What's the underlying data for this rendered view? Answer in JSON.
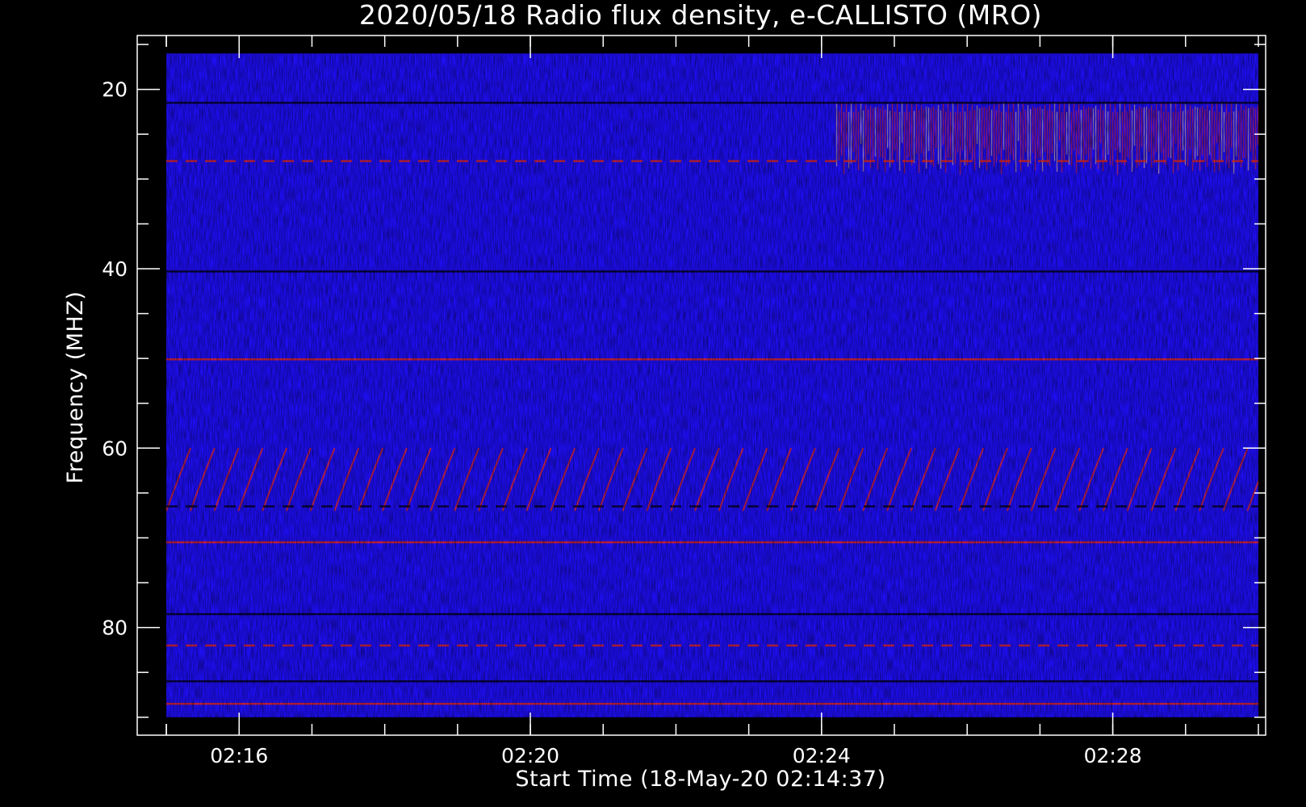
{
  "chart_data": {
    "type": "heatmap",
    "title": "2020/05/18  Radio flux density, e-CALLISTO (MRO)",
    "xlabel": "Start Time (18-May-20 02:14:37)",
    "ylabel": "Frequency (MHZ)",
    "x_ticks": [
      {
        "label": "02:16",
        "minutes": 16
      },
      {
        "label": "02:20",
        "minutes": 20
      },
      {
        "label": "02:24",
        "minutes": 24
      },
      {
        "label": "02:28",
        "minutes": 28
      }
    ],
    "x_minor_step_minutes": 1,
    "x_range_minutes": [
      14.6,
      30.1
    ],
    "data_x_range_minutes": [
      15.0,
      30.0
    ],
    "y_ticks": [
      20,
      40,
      60,
      80
    ],
    "y_minor_step": 5,
    "y_range": [
      14,
      92
    ],
    "data_y_range": [
      16,
      90
    ],
    "y_reversed": true,
    "colormap": {
      "low": "#000000",
      "mid": "#1a0aff",
      "high": "#ff2a00",
      "peak": "#ffd27a"
    },
    "background_color": "#1e0ef0",
    "features": {
      "horizontal_interference_lines_mhz": [
        21.5,
        28,
        40.3,
        50.1,
        66.5,
        70.5,
        78.5,
        82,
        86,
        88.5
      ],
      "drifting_bursts_band_mhz": [
        60,
        67
      ],
      "high_intensity_band_mhz": [
        22,
        29
      ],
      "high_intensity_start_minutes": 24.2
    }
  }
}
